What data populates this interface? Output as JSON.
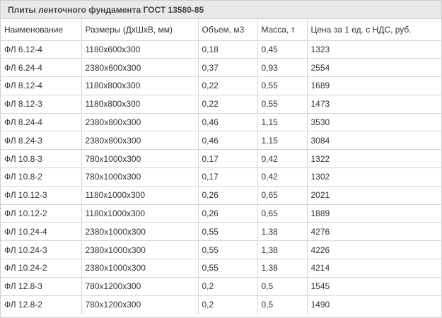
{
  "table": {
    "caption": "Плиты ленточного фундамента ГОСТ 13580-85",
    "headers": [
      "Наименование",
      "Размеры (ДхШхВ, мм)",
      "Объем, м3",
      "Масса, т",
      "Цена за 1 ед. с НДС, руб."
    ],
    "rows": [
      [
        "ФЛ 6.12-4",
        "1180х600х300",
        "0,18",
        "0,45",
        "1323"
      ],
      [
        "ФЛ 6.24-4",
        "2380х600х300",
        "0,37",
        "0,93",
        "2554"
      ],
      [
        "ФЛ 8.12-4",
        "1180х800х300",
        "0,22",
        "0,55",
        "1689"
      ],
      [
        "ФЛ 8.12-3",
        "1180х800х300",
        "0,22",
        "0,55",
        "1473"
      ],
      [
        "ФЛ 8.24-4",
        "2380х800х300",
        "0,46",
        "1,15",
        "3530"
      ],
      [
        "ФЛ 8.24-3",
        "2380х800х300",
        "0,46",
        "1,15",
        "3084"
      ],
      [
        "ФЛ 10.8-3",
        "780х1000х300",
        "0,17",
        "0,42",
        "1322"
      ],
      [
        "ФЛ 10.8-2",
        "780х1000х300",
        "0,17",
        "0,42",
        "1302"
      ],
      [
        "ФЛ 10.12-3",
        "1180х1000х300",
        "0,26",
        "0,65",
        "2021"
      ],
      [
        "ФЛ 10.12-2",
        "1180х1000х300",
        "0,26",
        "0,65",
        "1889"
      ],
      [
        "ФЛ 10.24-4",
        "2380х1000х300",
        "0,55",
        "1,38",
        "4276"
      ],
      [
        "ФЛ 10.24-3",
        "2380х1000х300",
        "0,55",
        "1,38",
        "4226"
      ],
      [
        "ФЛ 10.24-2",
        "2380х1000х300",
        "0,55",
        "1,38",
        "4214"
      ],
      [
        "ФЛ 12.8-3",
        "780х1200х300",
        "0,2",
        "0,5",
        "1545"
      ],
      [
        "ФЛ 12.8-2",
        "780х1200х300",
        "0,2",
        "0,5",
        "1490"
      ]
    ]
  }
}
